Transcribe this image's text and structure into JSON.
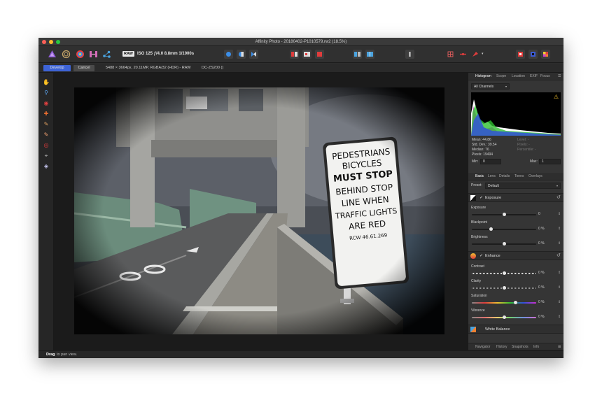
{
  "window": {
    "title": "Affinity Photo - 20180402-P1010579.rw2 (18.5%)"
  },
  "toolbar": {
    "raw_badge": "RAW",
    "camera_info": "ISO 125 ƒ/4.0 8.8mm 1/1000s"
  },
  "context": {
    "develop_label": "Develop",
    "cancel_label": "Cancel",
    "image_info": "5488 × 3664px, 20.11MP, RGBA/32 (HDR) - RAW",
    "camera_model": "DC-ZS200 ()"
  },
  "photo": {
    "sign_lines": [
      "PEDESTRIANS",
      "BICYCLES",
      "MUST STOP",
      "BEHIND STOP",
      "LINE WHEN",
      "TRAFFIC LIGHTS",
      "ARE RED",
      "RCW 46.61.269"
    ]
  },
  "panel_tabs": {
    "histogram": "Histogram",
    "scope": "Scope",
    "location": "Location",
    "exif": "EXIF",
    "focus": "Focus"
  },
  "histogram": {
    "channel": "All Channels",
    "mean": "Mean: 44.86",
    "std_dev": "Std. Dev.: 39.54",
    "median": "Median: 76",
    "pixels": "Pixels: 19494",
    "level": "Level: -",
    "count": "Pixels: -",
    "percentile": "Percentile: -",
    "min_label": "Min:",
    "min_value": "0",
    "max_label": "Max:",
    "max_value": "1"
  },
  "develop_tabs": {
    "basic": "Basic",
    "lens": "Lens",
    "details": "Details",
    "tones": "Tones",
    "overlays": "Overlays"
  },
  "preset": {
    "label": "Preset:",
    "value": "Default"
  },
  "exposure": {
    "section": "Exposure",
    "exposure_label": "Exposure",
    "exposure_value": "0",
    "exposure_level": 0.5,
    "blackpoint_label": "Blackpoint",
    "blackpoint_value": "0 %",
    "blackpoint_level": 0.3,
    "brightness_label": "Brightness",
    "brightness_value": "0 %",
    "brightness_level": 0.5
  },
  "enhance": {
    "section": "Enhance",
    "contrast_label": "Contrast",
    "contrast_value": "0 %",
    "contrast_level": 0.5,
    "clarity_label": "Clarity",
    "clarity_value": "0 %",
    "clarity_level": 0.5,
    "saturation_label": "Saturation",
    "saturation_value": "0 %",
    "saturation_level": 0.68,
    "vibrance_label": "Vibrance",
    "vibrance_value": "0 %",
    "vibrance_level": 0.5
  },
  "white_balance": {
    "section": "White Balance"
  },
  "bottom_tabs": {
    "navigator": "Navigator",
    "history": "History",
    "snapshots": "Snapshots",
    "info": "Info"
  },
  "status": {
    "action": "Drag",
    "hint": "to pan view."
  },
  "colors": {
    "accent": "#3d63d6",
    "close": "#fc5f57",
    "minimize": "#fdbc2e",
    "maximize": "#28c840"
  }
}
